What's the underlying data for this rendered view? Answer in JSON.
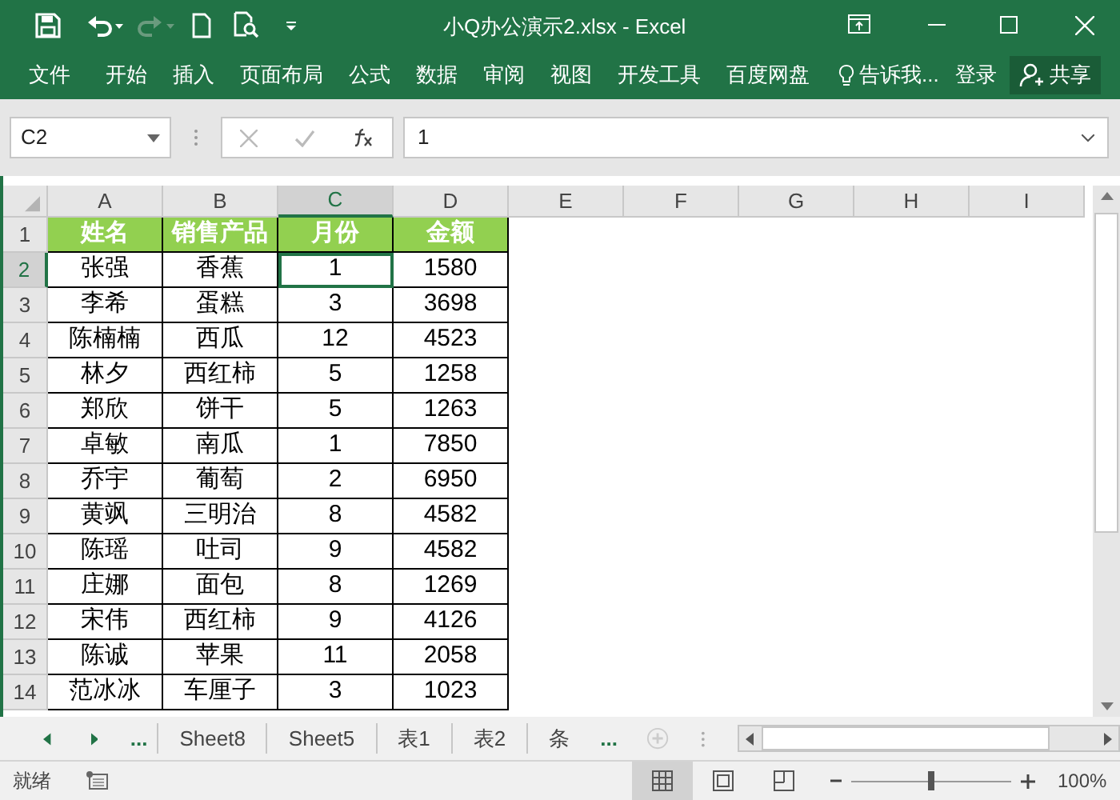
{
  "window": {
    "title": "小Q办公演示2.xlsx - Excel"
  },
  "ribbon_tabs": [
    {
      "label": "文件"
    },
    {
      "label": "开始"
    },
    {
      "label": "插入"
    },
    {
      "label": "页面布局"
    },
    {
      "label": "公式"
    },
    {
      "label": "数据"
    },
    {
      "label": "审阅"
    },
    {
      "label": "视图"
    },
    {
      "label": "开发工具"
    },
    {
      "label": "百度网盘"
    }
  ],
  "tell_me": "告诉我...",
  "sign_in": "登录",
  "share": "共享",
  "formula_bar": {
    "name_box": "C2",
    "value": "1"
  },
  "columns": [
    {
      "label": "A",
      "selected": false
    },
    {
      "label": "B",
      "selected": false
    },
    {
      "label": "C",
      "selected": true
    },
    {
      "label": "D",
      "selected": false
    },
    {
      "label": "E",
      "selected": false
    },
    {
      "label": "F",
      "selected": false
    },
    {
      "label": "G",
      "selected": false
    },
    {
      "label": "H",
      "selected": false
    },
    {
      "label": "I",
      "selected": false
    }
  ],
  "rows": [
    {
      "number": "1",
      "kind": "header",
      "selected": false,
      "cells": [
        "姓名",
        "销售产品",
        "月份",
        "金额"
      ]
    },
    {
      "number": "2",
      "kind": "data",
      "selected": true,
      "cells": [
        "张强",
        "香蕉",
        "1",
        "1580"
      ]
    },
    {
      "number": "3",
      "kind": "data",
      "selected": false,
      "cells": [
        "李希",
        "蛋糕",
        "3",
        "3698"
      ]
    },
    {
      "number": "4",
      "kind": "data",
      "selected": false,
      "cells": [
        "陈楠楠",
        "西瓜",
        "12",
        "4523"
      ]
    },
    {
      "number": "5",
      "kind": "data",
      "selected": false,
      "cells": [
        "林夕",
        "西红柿",
        "5",
        "1258"
      ]
    },
    {
      "number": "6",
      "kind": "data",
      "selected": false,
      "cells": [
        "郑欣",
        "饼干",
        "5",
        "1263"
      ]
    },
    {
      "number": "7",
      "kind": "data",
      "selected": false,
      "cells": [
        "卓敏",
        "南瓜",
        "1",
        "7850"
      ]
    },
    {
      "number": "8",
      "kind": "data",
      "selected": false,
      "cells": [
        "乔宇",
        "葡萄",
        "2",
        "6950"
      ]
    },
    {
      "number": "9",
      "kind": "data",
      "selected": false,
      "cells": [
        "黄飒",
        "三明治",
        "8",
        "4582"
      ]
    },
    {
      "number": "10",
      "kind": "data",
      "selected": false,
      "cells": [
        "陈瑶",
        "吐司",
        "9",
        "4582"
      ]
    },
    {
      "number": "11",
      "kind": "data",
      "selected": false,
      "cells": [
        "庄娜",
        "面包",
        "8",
        "1269"
      ]
    },
    {
      "number": "12",
      "kind": "data",
      "selected": false,
      "cells": [
        "宋伟",
        "西红柿",
        "9",
        "4126"
      ]
    },
    {
      "number": "13",
      "kind": "data",
      "selected": false,
      "cells": [
        "陈诚",
        "苹果",
        "11",
        "2058"
      ]
    },
    {
      "number": "14",
      "kind": "data",
      "selected": false,
      "cells": [
        "范冰冰",
        "车厘子",
        "3",
        "1023"
      ]
    }
  ],
  "sheet_tabs": [
    {
      "label": "...",
      "kind": "more"
    },
    {
      "label": "Sheet8",
      "kind": "sheet"
    },
    {
      "label": "Sheet5",
      "kind": "sheet"
    },
    {
      "label": "表1",
      "kind": "sheet"
    },
    {
      "label": "表2",
      "kind": "sheet"
    },
    {
      "label": "条",
      "kind": "sheet"
    },
    {
      "label": "...",
      "kind": "more"
    }
  ],
  "status_bar": {
    "status": "就绪",
    "views": [
      {
        "selected": true
      },
      {
        "selected": false
      },
      {
        "selected": false
      }
    ],
    "zoom_slider": {
      "level": 0.5
    },
    "zoom": "100%"
  }
}
